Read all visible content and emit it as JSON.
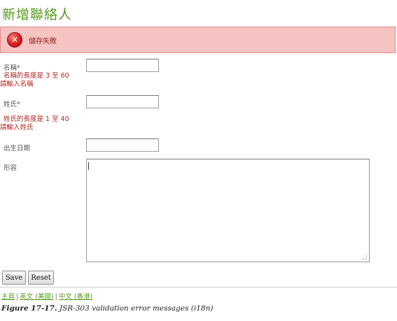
{
  "page": {
    "title": "新增聯絡人"
  },
  "error": {
    "icon": "close-icon",
    "message": "儲存失敗"
  },
  "form": {
    "first_name": {
      "label": "名稱*",
      "value": "",
      "error": "名稱的長度是 3 至 60",
      "error2": "請輸入名稱"
    },
    "last_name": {
      "label": "姓氏*",
      "value": "",
      "error": "姓氏的長度是 1 至 40",
      "error2": "請輸入姓氏"
    },
    "birth_date": {
      "label": "出生日期",
      "value": ""
    },
    "description": {
      "label": "形容",
      "value": ""
    }
  },
  "buttons": {
    "save": "Save",
    "reset": "Reset"
  },
  "footer": {
    "home": "主頁",
    "sep": "|",
    "english": "英文 (美國)",
    "chinese": "中文 (香港)"
  },
  "caption": {
    "number": "Figure 17-17.",
    "text": "JSR-303 validation error messages (i18n)"
  },
  "colors": {
    "title": "#5a9a1e",
    "error_bg": "#f6c3c3",
    "error_text": "#b22222"
  }
}
